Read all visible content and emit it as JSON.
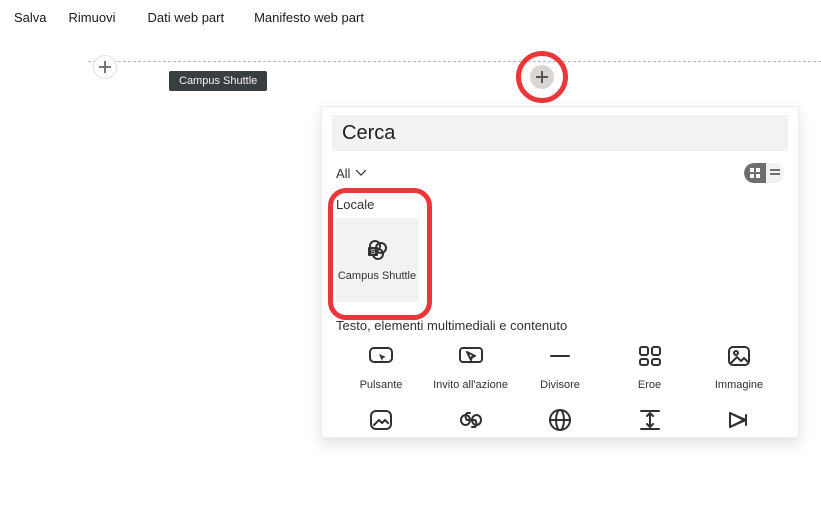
{
  "topbar": {
    "save": "Salva",
    "remove": "Rimuovi",
    "data": "Dati web part",
    "manifest": "Manifesto web part"
  },
  "tooltip": "Campus Shuttle",
  "panel": {
    "search": "Cerca",
    "filter": "All",
    "local_label": "Locale",
    "local_item": "Campus Shuttle",
    "cat2": "Testo, elementi multimediali e contenuto",
    "row1": {
      "0": "Pulsante",
      "1": "Invito all'azione",
      "2": "Divisore",
      "3": "Eroe",
      "4": "Immagine"
    }
  }
}
